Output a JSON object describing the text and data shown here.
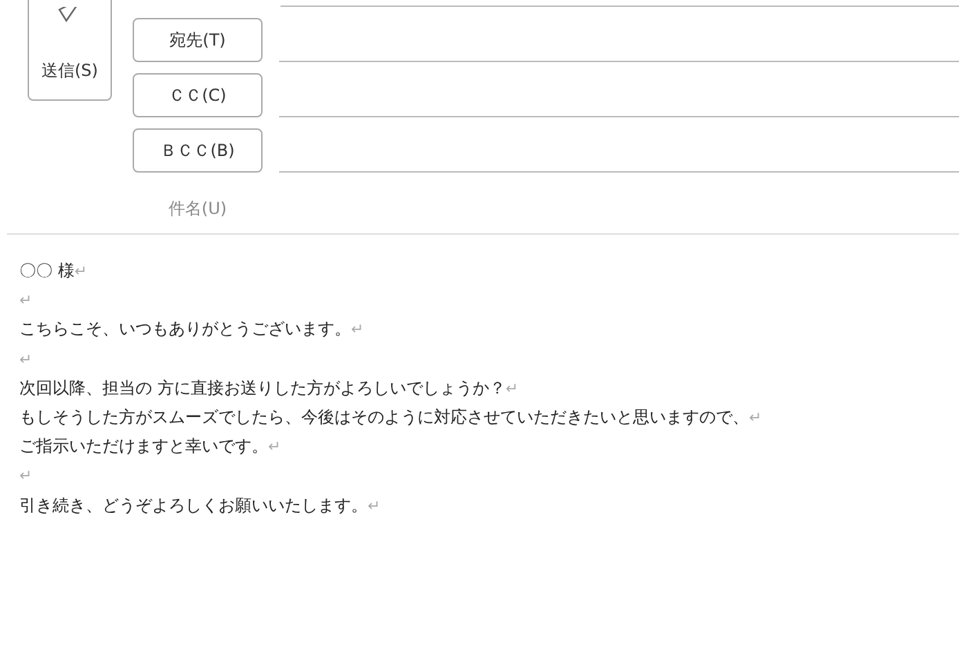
{
  "send_button": {
    "label": "送信(S)"
  },
  "address_buttons": [
    {
      "label": "宛先(T)"
    },
    {
      "label": "ＣＣ(C)"
    },
    {
      "label": "ＢＣＣ(B)"
    }
  ],
  "subject": {
    "label": "件名(U)"
  },
  "body": {
    "lines": [
      {
        "text": "〇〇 様",
        "mark": "↵"
      },
      {
        "mark": "↵"
      },
      {
        "text": "こちらこそ、いつもありがとうございます。",
        "mark": "↵"
      },
      {
        "mark": "↵"
      },
      {
        "text": "次回以降、担当の 方に直接お送りした方がよろしいでしょうか？",
        "mark": "↵"
      },
      {
        "text": "もしそうした方がスムーズでしたら、今後はそのように対応させていただきたいと思いますので、",
        "mark": "↵"
      },
      {
        "text": "ご指示いただけますと幸いです。",
        "mark": "↵"
      },
      {
        "mark": "↵"
      },
      {
        "text": "引き続き、どうぞよろしくお願いいたします。",
        "mark": "↵"
      }
    ]
  }
}
